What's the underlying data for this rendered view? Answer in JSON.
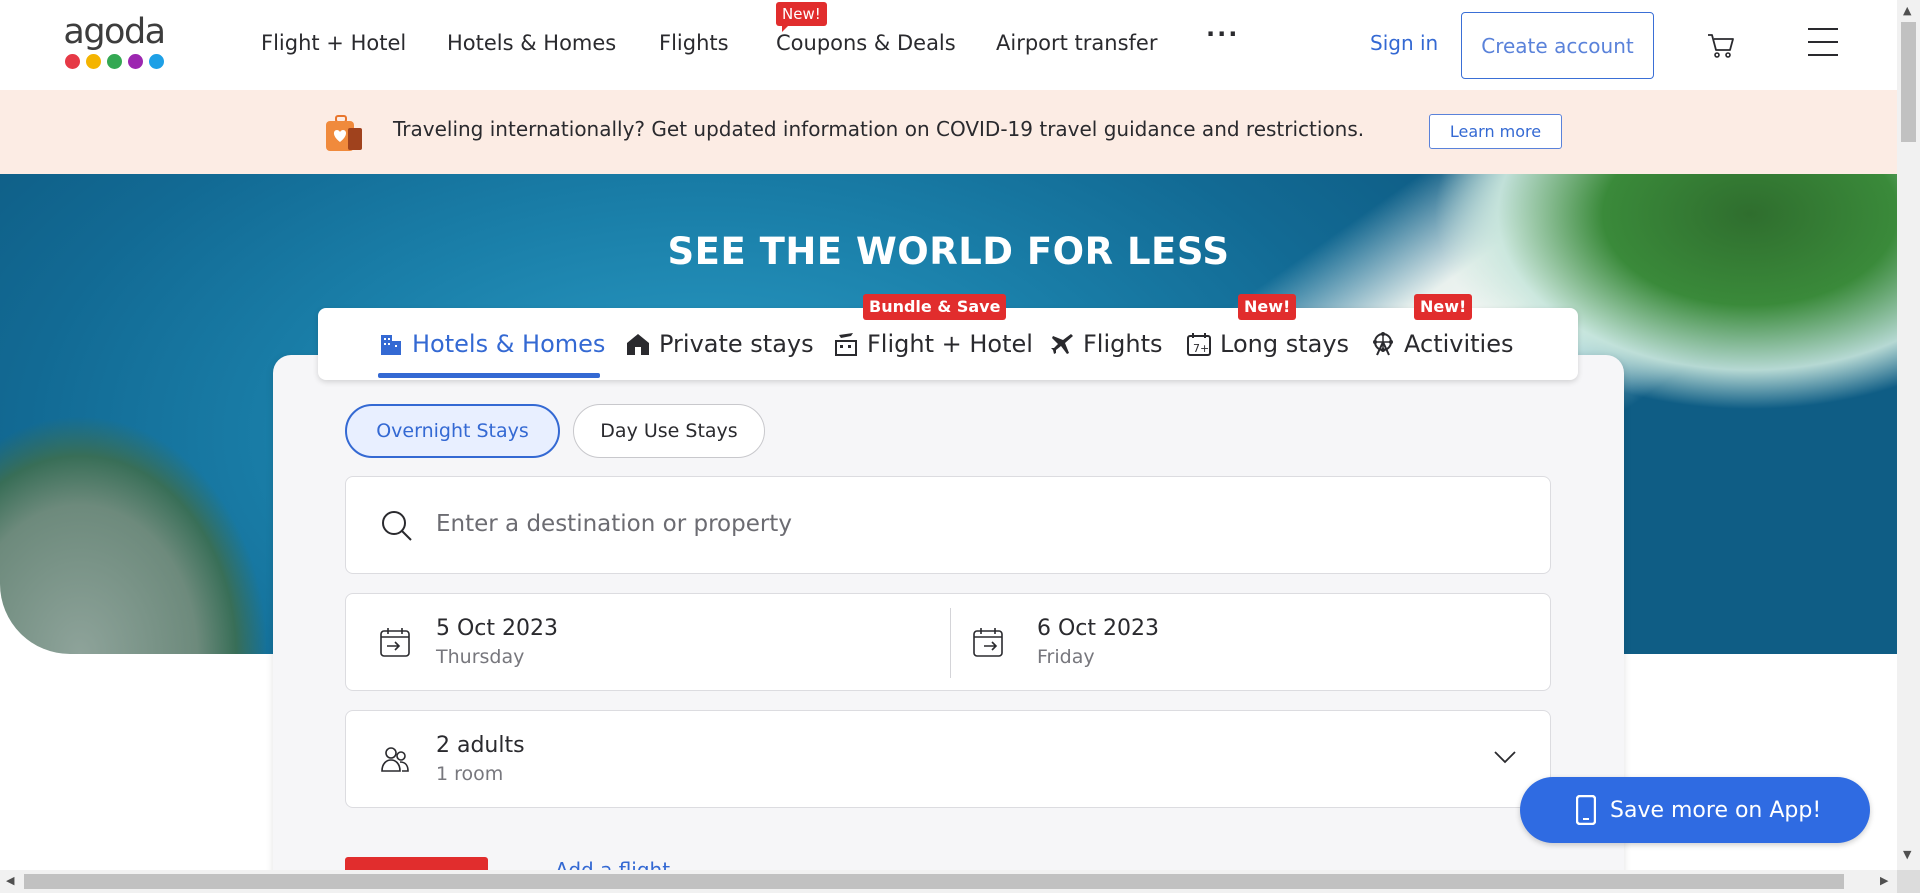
{
  "brand": {
    "name": "agoda",
    "dot_colors": [
      "#e63946",
      "#f4b400",
      "#34a853",
      "#9c27b0",
      "#1ea0e6"
    ]
  },
  "nav": {
    "items": [
      "Flight + Hotel",
      "Hotels & Homes",
      "Flights",
      "Coupons & Deals",
      "Airport transfer"
    ],
    "new_badge": "New!",
    "more": "···",
    "sign_in": "Sign in",
    "create_account": "Create account"
  },
  "covid_banner": {
    "text": "Traveling internationally? Get updated information on COVID-19 travel guidance and restrictions.",
    "button": "Learn more"
  },
  "hero": {
    "title": "SEE THE WORLD FOR LESS"
  },
  "tabs": {
    "items": [
      "Hotels & Homes",
      "Private stays",
      "Flight + Hotel",
      "Flights",
      "Long stays",
      "Activities"
    ],
    "active": "Hotels & Homes",
    "badges": {
      "flight_hotel": "Bundle & Save",
      "long_stays": "New!",
      "activities": "New!"
    }
  },
  "stay_type": {
    "overnight": "Overnight Stays",
    "day_use": "Day Use Stays",
    "selected": "Overnight Stays"
  },
  "search": {
    "placeholder": "Enter a destination or property"
  },
  "dates": {
    "check_in": {
      "date": "5 Oct 2023",
      "day": "Thursday"
    },
    "check_out": {
      "date": "6 Oct 2023",
      "day": "Friday"
    }
  },
  "guests": {
    "adults": "2 adults",
    "rooms": "1 room"
  },
  "bottom": {
    "add_flight": "Add a flight"
  },
  "app_promo": {
    "label": "Save more on App!"
  },
  "colors": {
    "accent": "#3469d3",
    "badge": "#e12d2d",
    "banner_bg": "#fcece4"
  }
}
